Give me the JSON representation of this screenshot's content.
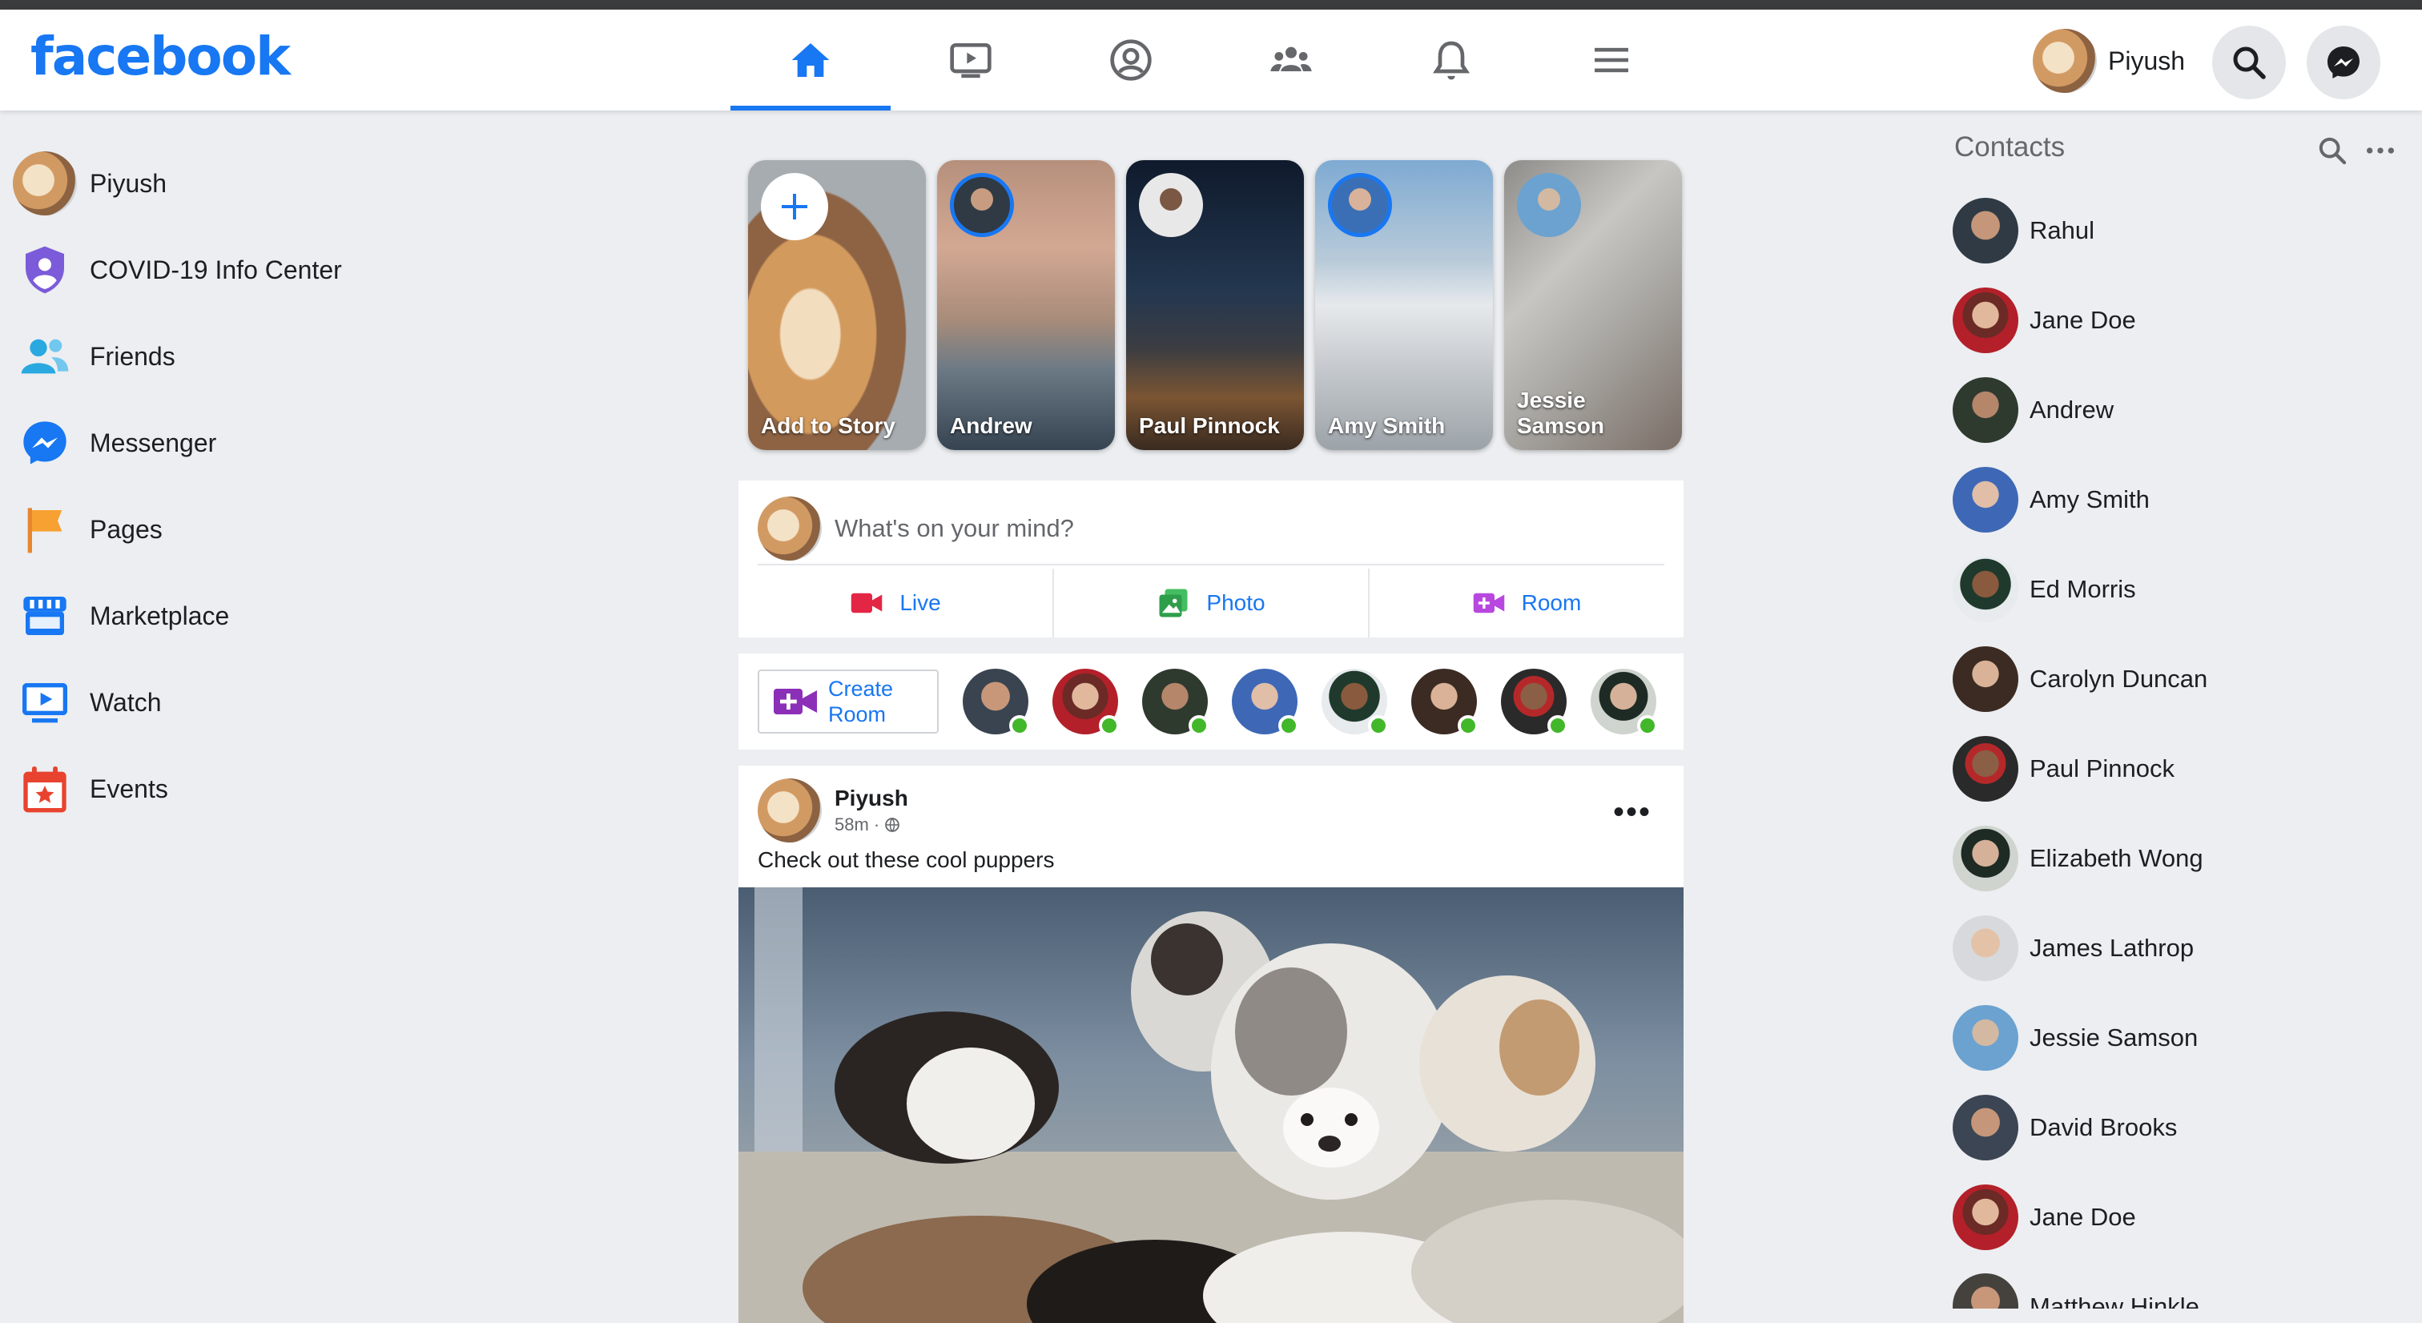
{
  "app": {
    "logo": "facebook"
  },
  "header": {
    "tabs": [
      {
        "name": "home",
        "icon": "home-icon",
        "active": true
      },
      {
        "name": "watch",
        "icon": "video-icon"
      },
      {
        "name": "profile",
        "icon": "user-circle-icon"
      },
      {
        "name": "groups",
        "icon": "groups-icon"
      },
      {
        "name": "notifications",
        "icon": "bell-icon"
      },
      {
        "name": "menu",
        "icon": "menu-icon"
      }
    ],
    "user_name": "Piyush"
  },
  "sidebar": {
    "items": [
      {
        "label": "Piyush",
        "icon": "avatar"
      },
      {
        "label": "COVID-19 Info Center",
        "icon": "shield-icon"
      },
      {
        "label": "Friends",
        "icon": "friends-icon"
      },
      {
        "label": "Messenger",
        "icon": "messenger-icon"
      },
      {
        "label": "Pages",
        "icon": "flag-icon"
      },
      {
        "label": "Marketplace",
        "icon": "store-icon"
      },
      {
        "label": "Watch",
        "icon": "watch-icon"
      },
      {
        "label": "Events",
        "icon": "calendar-icon"
      }
    ]
  },
  "stories": [
    {
      "name": "Add to Story"
    },
    {
      "name": "Andrew"
    },
    {
      "name": "Paul Pinnock"
    },
    {
      "name": "Amy Smith"
    },
    {
      "name": "Jessie Samson"
    }
  ],
  "composer": {
    "placeholder": "What's on your mind?",
    "actions": [
      {
        "label": "Live",
        "color": "#e42645"
      },
      {
        "label": "Photo",
        "color": "#45bd62"
      },
      {
        "label": "Room",
        "color": "#b847e0"
      }
    ]
  },
  "rooms": {
    "create_label_1": "Create",
    "create_label_2": "Room"
  },
  "post": {
    "author": "Piyush",
    "time": "58m",
    "text": "Check out these cool puppers"
  },
  "contacts": {
    "title": "Contacts",
    "list": [
      "Rahul",
      "Jane Doe",
      "Andrew",
      "Amy Smith",
      "Ed Morris",
      "Carolyn Duncan",
      "Paul Pinnock",
      "Elizabeth Wong",
      "James Lathrop",
      "Jessie Samson",
      "David Brooks",
      "Jane Doe",
      "Matthew Hinkle"
    ]
  },
  "colors": {
    "brand": "#1877f2",
    "online": "#42b72a"
  }
}
